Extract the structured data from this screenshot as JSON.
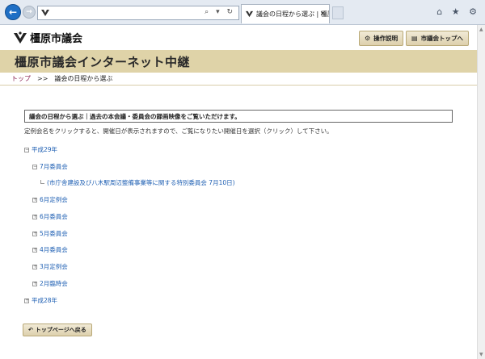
{
  "browser": {
    "tab_title": "議会の日程から選ぶ | 橿原...",
    "tab_close": "×",
    "address_tools": "⌕ ▾ ↻",
    "right_icons": "⌂ ★ ⚙"
  },
  "header": {
    "site_name": "橿原市議会",
    "manual_button": "操作説明",
    "top_button": "市議会トップへ"
  },
  "banner": {
    "title": "橿原市議会インターネット中継"
  },
  "breadcrumb": {
    "home": "トップ",
    "separator": ">>",
    "current": "議会の日程から選ぶ"
  },
  "info": {
    "heading": "議会の日程から選ぶ｜過去の本会議・委員会の録画映像をご覧いただけます。",
    "description": "定例会名をクリックすると、開催日が表示されますので、ご覧になりたい開催日を選択（クリック）して下さい。"
  },
  "tree": {
    "y29": {
      "toggle": "−",
      "label": "平成29年"
    },
    "july_committee": {
      "toggle": "−",
      "label": "7月委員会"
    },
    "special_committee": {
      "label": "(市庁舎建設及び八木駅周辺整備事業等に関する特別委員会 7月10日)"
    },
    "june_session": {
      "toggle": "+",
      "label": "6月定例会"
    },
    "june_committee": {
      "toggle": "+",
      "label": "6月委員会"
    },
    "may_committee": {
      "toggle": "+",
      "label": "5月委員会"
    },
    "april_committee": {
      "toggle": "+",
      "label": "4月委員会"
    },
    "march_session": {
      "toggle": "+",
      "label": "3月定例会"
    },
    "feb_extra": {
      "toggle": "+",
      "label": "2月臨時会"
    },
    "y28": {
      "toggle": "+",
      "label": "平成28年"
    }
  },
  "footer": {
    "back_button": "トップページへ戻る"
  },
  "colors": {
    "banner": "#dfd3a8",
    "link": "#1e5fb3",
    "breadcrumb_home": "#8a2152"
  }
}
